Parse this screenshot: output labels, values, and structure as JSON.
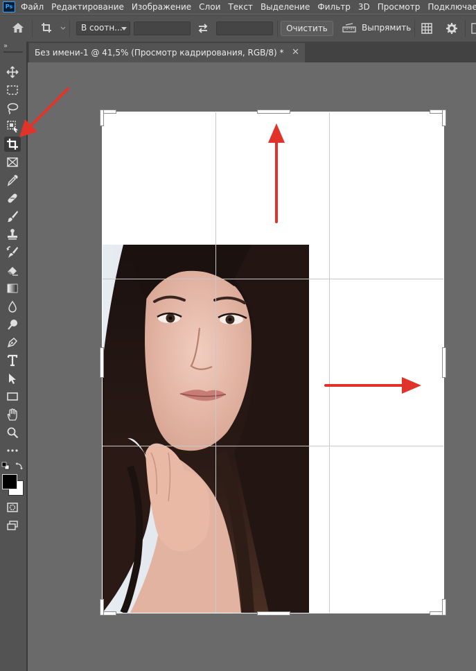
{
  "menubar": {
    "logo": "Ps",
    "items": [
      "Файл",
      "Редактирование",
      "Изображение",
      "Слои",
      "Текст",
      "Выделение",
      "Фильтр",
      "3D",
      "Просмотр",
      "Подключаемые модули"
    ]
  },
  "options": {
    "ratio_select": "В соотн...",
    "width_value": "",
    "height_value": "",
    "clear_button": "Очистить",
    "straighten_label": "Выпрямить"
  },
  "toolbox": {
    "collapse_glyph": "»"
  },
  "document": {
    "tab_title": "Без имени-1 @ 41,5% (Просмотр кадрирования, RGB/8) *",
    "close_glyph": "✕"
  },
  "annotations": {
    "color": "#e0332a",
    "arrows": [
      "pointing to crop tool",
      "expand up",
      "expand right"
    ]
  },
  "colors": {
    "app_bg": "#535353",
    "canvas_bg": "#6a6a6a",
    "accent": "#31a8ff"
  }
}
